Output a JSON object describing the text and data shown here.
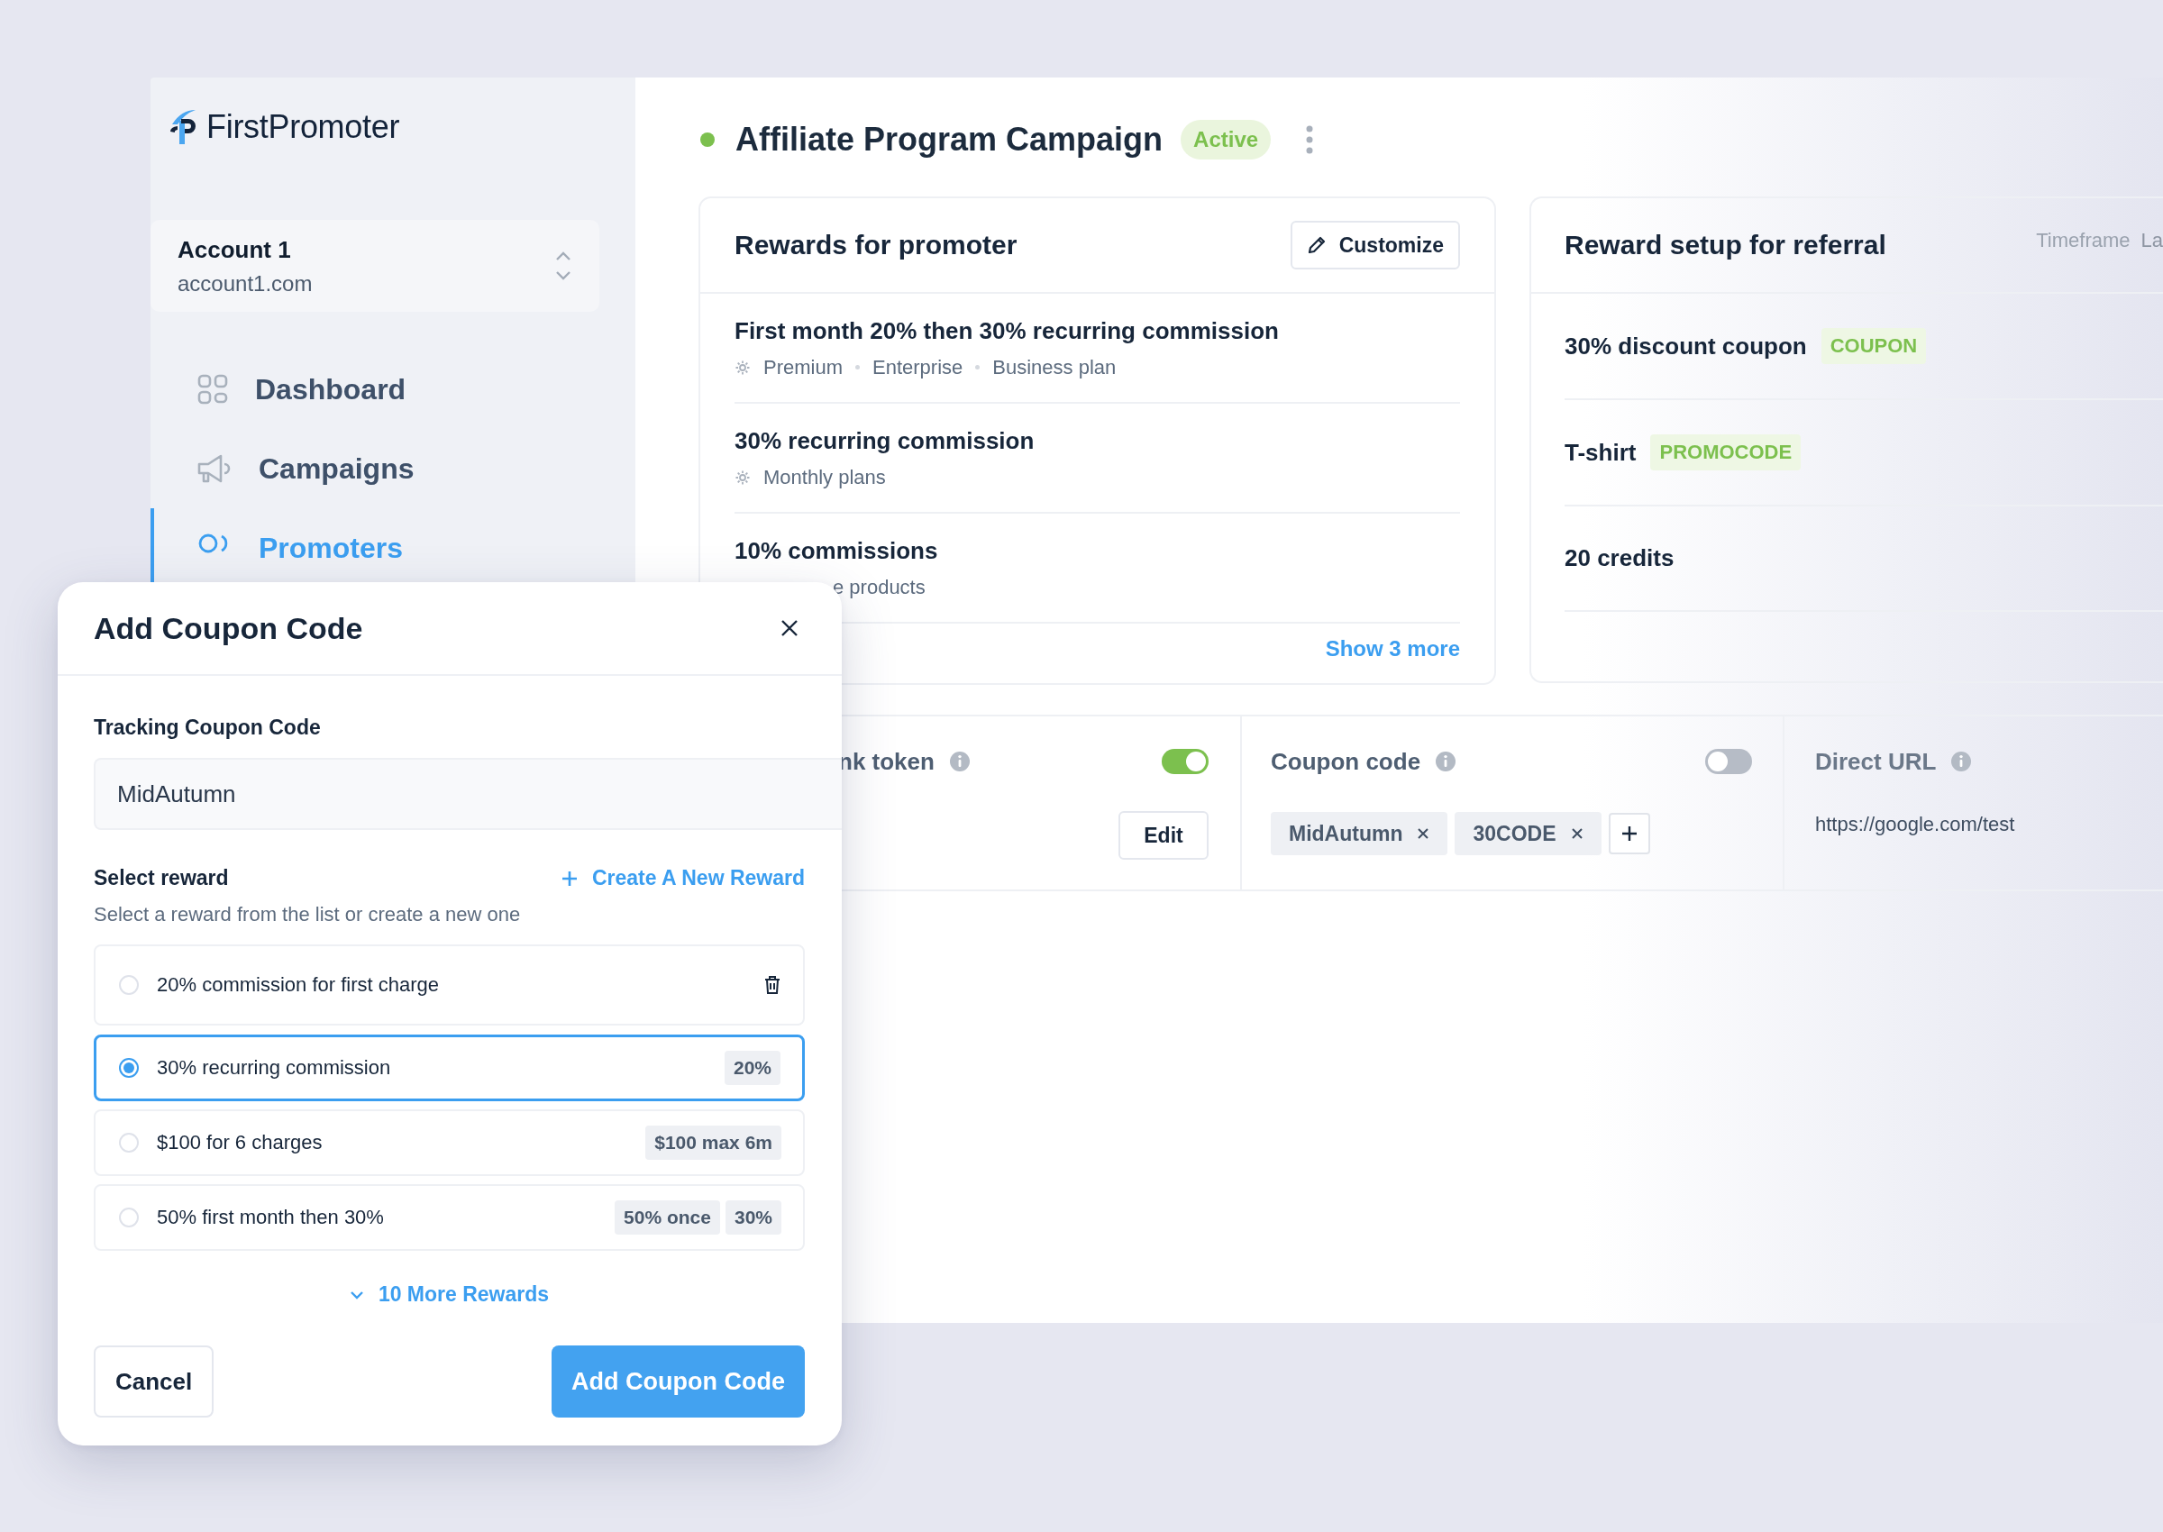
{
  "sidebar": {
    "brand": "FirstPromoter",
    "account": {
      "name": "Account 1",
      "domain": "account1.com"
    },
    "nav": [
      {
        "label": "Dashboard",
        "selected": false
      },
      {
        "label": "Campaigns",
        "selected": false
      },
      {
        "label": "Promoters",
        "selected": true
      }
    ]
  },
  "campaign": {
    "title": "Affiliate Program Campaign",
    "active": true,
    "status": "Active"
  },
  "promoter_rewards": {
    "title": "Rewards for promoter",
    "customize_button": "Customize",
    "rewards": [
      {
        "title": "First month 20% then 30% recurring commission",
        "plans": [
          "Premium",
          "Enterprise",
          "Business plan"
        ],
        "kind": "full"
      },
      {
        "title": "30% recurring commission",
        "plans": [
          "Monthly plans"
        ],
        "kind": "full"
      },
      {
        "title": "10% commissions",
        "plans": [
          "e products"
        ],
        "kind": "covered"
      }
    ],
    "show_more": "Show 3 more"
  },
  "referral_rewards": {
    "title": "Reward setup for referral",
    "timeframe_label": "Timeframe",
    "timeframe_value": "La",
    "rewards": [
      {
        "title": "30% discount coupon",
        "tag": "COUPON"
      },
      {
        "title": "T-shirt",
        "tag": "PROMOCODE"
      },
      {
        "title": "20 credits"
      }
    ]
  },
  "tracking": [
    {
      "kind": "token",
      "label": "nk token",
      "on": true,
      "button": "Edit"
    },
    {
      "kind": "coupons",
      "label": "Coupon code",
      "on": false,
      "chips": [
        "MidAutumn",
        "30CODE"
      ]
    },
    {
      "kind": "url",
      "label": "Direct URL",
      "value": "https://google.com/test"
    }
  ],
  "modal": {
    "title": "Add Coupon Code",
    "field_label": "Tracking Coupon Code",
    "field_value": "MidAutumn",
    "section_title": "Select reward",
    "create_link": "Create A New Reward",
    "section_hint": "Select a reward from the list or create a new one",
    "options": [
      {
        "label": "20% commission for first charge",
        "selected": false,
        "deletable": true
      },
      {
        "label": "30% recurring commission",
        "selected": true,
        "deletable": false,
        "tags": [
          "20%"
        ]
      },
      {
        "label": "$100 for 6 charges",
        "selected": false,
        "deletable": false,
        "tags": [
          "$100 max 6m"
        ]
      },
      {
        "label": "50% first month then 30%",
        "selected": false,
        "deletable": false,
        "tags": [
          "50% once",
          "30%"
        ]
      }
    ],
    "more_link": "10 More Rewards",
    "cancel_button": "Cancel",
    "submit_button": "Add Coupon Code"
  }
}
